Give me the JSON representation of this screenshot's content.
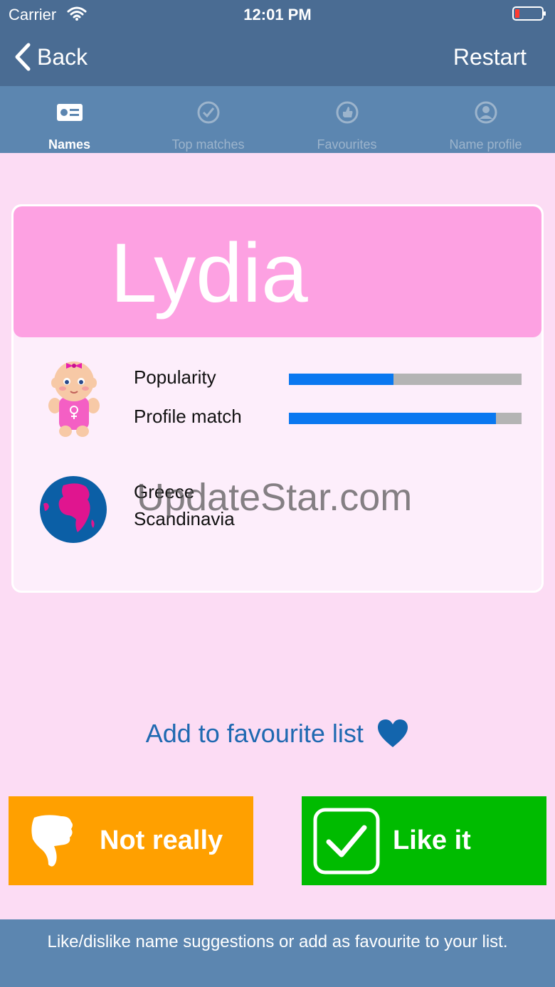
{
  "status": {
    "carrier": "Carrier",
    "time": "12:01 PM"
  },
  "nav": {
    "back_label": "Back",
    "restart_label": "Restart"
  },
  "tabs": [
    {
      "label": "Names",
      "icon": "id-card-icon",
      "active": true
    },
    {
      "label": "Top matches",
      "icon": "checkmark-circle-icon",
      "active": false
    },
    {
      "label": "Favourites",
      "icon": "thumb-circle-icon",
      "active": false
    },
    {
      "label": "Name profile",
      "icon": "person-circle-icon",
      "active": false
    }
  ],
  "card": {
    "name": "Lydia",
    "popularity_label": "Popularity",
    "popularity_value": 0.45,
    "profile_match_label": "Profile match",
    "profile_match_value": 0.89,
    "origins": [
      "Greece",
      "Scandinavia"
    ]
  },
  "watermark": "UpdateStar.com",
  "favourite": {
    "label": "Add to favourite list",
    "icon": "heart-icon"
  },
  "buttons": {
    "dislike_label": "Not really",
    "like_label": "Like it"
  },
  "footer": {
    "hint": "Like/dislike name suggestions or add as favourite to your list."
  },
  "colors": {
    "nav_bg": "#4a6c93",
    "tab_bg": "#5c86b0",
    "page_bg": "#fcdcf4",
    "card_header": "#fda1e2",
    "bar_fill": "#0a78f0",
    "dislike": "#ffa000",
    "like": "#00bb00",
    "link": "#1f69b1"
  }
}
